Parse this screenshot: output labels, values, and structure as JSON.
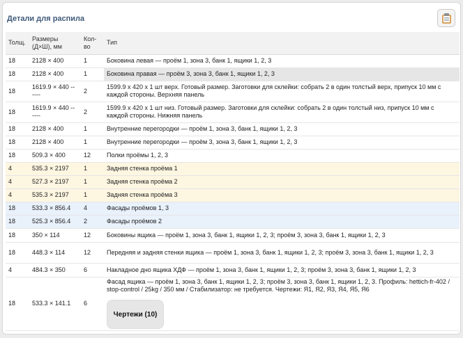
{
  "panel": {
    "title": "Детали для распила"
  },
  "table": {
    "headers": {
      "thickness": "Толщ.",
      "sizes": "Размеры (Д×Ш), мм",
      "qty": "Кол-во",
      "type": "Тип"
    },
    "rows": [
      {
        "thickness": "18",
        "sizes": "2128 × 400",
        "qty": "1",
        "type": "Боковина левая — проём 1, зона 3, банк 1, ящики 1, 2, 3"
      },
      {
        "thickness": "18",
        "sizes": "2128 × 400",
        "qty": "1",
        "type": "Боковина правая — проём 3, зона 3, банк 1, ящики 1, 2, 3"
      },
      {
        "thickness": "18",
        "sizes": "1619.9 × 440 -- ----",
        "qty": "2",
        "type": "1599.9 x 420 x 1 шт верх. Готовый размер. Заготовки для склейки: собрать 2 в один толстый верх, припуск 10 мм с каждой стороны. Верхняя панель"
      },
      {
        "thickness": "18",
        "sizes": "1619.9 × 440 -- ----",
        "qty": "2",
        "type": "1599.9 x 420 x 1 шт низ. Готовый размер. Заготовки для склейки: собрать 2 в один толстый низ, припуск 10 мм с каждой стороны. Нижняя панель"
      },
      {
        "thickness": "18",
        "sizes": "2128 × 400",
        "qty": "1",
        "type": "Внутренние перегородки — проём 1, зона 3, банк 1, ящики 1, 2, 3"
      },
      {
        "thickness": "18",
        "sizes": "2128 × 400",
        "qty": "1",
        "type": "Внутренние перегородки — проём 3, зона 3, банк 1, ящики 1, 2, 3"
      },
      {
        "thickness": "18",
        "sizes": "509.3 × 400",
        "qty": "12",
        "type": "Полки проёмы 1, 2, 3"
      },
      {
        "thickness": "4",
        "sizes": "535.3 × 2197",
        "qty": "1",
        "type": "Задняя стенка проёма 1"
      },
      {
        "thickness": "4",
        "sizes": "527.3 × 2197",
        "qty": "1",
        "type": "Задняя стенка проёма 2"
      },
      {
        "thickness": "4",
        "sizes": "535.3 × 2197",
        "qty": "1",
        "type": "Задняя стенка проёма 3"
      },
      {
        "thickness": "18",
        "sizes": "533.3 × 856.4",
        "qty": "4",
        "type": "Фасады проёмов 1, 3"
      },
      {
        "thickness": "18",
        "sizes": "525.3 × 856.4",
        "qty": "2",
        "type": "Фасады проёмов 2"
      },
      {
        "thickness": "18",
        "sizes": "350 × 114",
        "qty": "12",
        "type": "Боковины ящика — проём 1, зона 3, банк 1, ящики 1, 2, 3; проём 3, зона 3, банк 1, ящики 1, 2, 3"
      },
      {
        "thickness": "18",
        "sizes": "448.3 × 114",
        "qty": "12",
        "type": "Передняя и задняя стенки ящика — проём 1, зона 3, банк 1, ящики 1, 2, 3; проём 3, зона 3, банк 1, ящики 1, 2, 3"
      },
      {
        "thickness": "4",
        "sizes": "484.3 × 350",
        "qty": "6",
        "type": "Накладное дно ящика ХДФ — проём 1, зона 3, банк 1, ящики 1, 2, 3; проём 3, зона 3, банк 1, ящики 1, 2, 3"
      },
      {
        "thickness": "18",
        "sizes": "533.3 × 141.1",
        "qty": "6",
        "type": "Фасад ящика — проём 1, зона 3, банк 1, ящики 1, 2, 3; проём 3, зона 3, банк 1, ящики 1, 2, 3. Профиль: hettich-fr-402 / stop-control / 25kg / 350 мм / Стабилизатор: не требуется. Чертежи: Я1, Я2, Я3, Я4, Я5, Я6",
        "button": "Чертежи (10)"
      }
    ]
  },
  "icons": {
    "copy": "clipboard-icon"
  },
  "colors": {
    "title": "#3f5a7a",
    "back_row": "#fdf6e1",
    "facade_row": "#e9f1fb",
    "highlight": "#e6e6e6"
  }
}
